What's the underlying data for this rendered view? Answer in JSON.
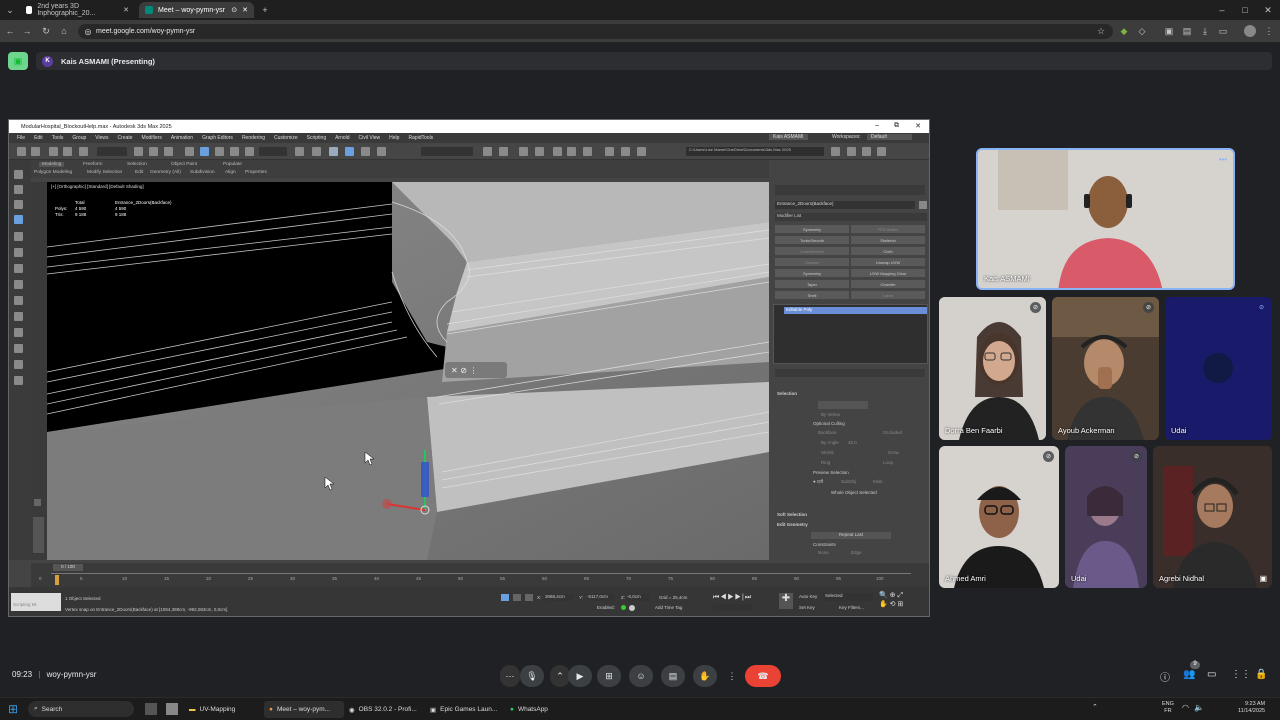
{
  "browser": {
    "tabs": [
      {
        "title": "2nd years 3D Inphographic_20..."
      },
      {
        "title": "Meet – woy-pymn-ysr"
      }
    ],
    "url": "meet.google.com/woy-pymn-ysr"
  },
  "meet": {
    "presenting_label": "Kais ASMAMI (Presenting)",
    "presenter_initial": "K",
    "time": "09:23",
    "meeting_code": "woy-pymn-ysr",
    "participants": [
      {
        "name": "Kais ASMAMI"
      },
      {
        "name": "Dorra Ben Faarbi"
      },
      {
        "name": "Ayoub Ackerman"
      },
      {
        "name": "Udai"
      },
      {
        "name": "Ahmed Amri"
      },
      {
        "name": "Udai"
      },
      {
        "name": "Agrebi Nidhal"
      }
    ],
    "people_badge": "9"
  },
  "max": {
    "title": "ModularHospital_BlockoutHelp.max - Autodesk 3ds Max 2025",
    "menu": [
      "File",
      "Edit",
      "Tools",
      "Group",
      "Views",
      "Create",
      "Modifiers",
      "Animation",
      "Graph Editors",
      "Rendering",
      "Customize",
      "Scripting",
      "Arnold",
      "Civil View",
      "Help",
      "RapidTools"
    ],
    "user": "Kais ASMAMI",
    "workspace_label": "Workspaces:",
    "workspace": "Default",
    "ribbon_tabs": [
      "Modeling",
      "Freeform",
      "Selection",
      "Object Paint",
      "Populate"
    ],
    "ribbon_sub": [
      "Polygon Modeling",
      "Modify Selection",
      "Edit",
      "Geometry (All)",
      "Subdivision",
      "Align",
      "Properties"
    ],
    "path": "C:\\Users\\Lise Mame\\OneDrive\\Documents\\3ds Max 2025",
    "viewport_label": "[+] [Orthographic] [Standard] [Default Shading]",
    "stats": {
      "h1": "Total",
      "h2": "Entrance_2Doors(Backface)",
      "polys_label": "Polys:",
      "polys_total": "4 590",
      "polys_sel": "4 590",
      "tris_label": "Tris:",
      "tris_total": "9 188",
      "tris_sel": "9 188"
    },
    "object_name": "Entrance_2Doors(Backface)",
    "modifier_list": "Modifier List",
    "modifier_buttons": [
      "Symmetry",
      "FFD Select",
      "TurboSmooth",
      "Skeleton",
      "CrossSection",
      "Cloth",
      "Surface",
      "Unwrap UVW",
      "Symmetry",
      "UVW Mapping Clear",
      "Taper",
      "Chamfer",
      "Shell",
      "Lathe"
    ],
    "stack_item": "Editable Poly",
    "rollouts": {
      "selection": "Selection",
      "by_vertex": "By Vertex",
      "optional_culling": "Optional Culling",
      "backface": "Backface",
      "occluded": "Occluded",
      "by_angle": "By Angle",
      "angle_val": "45.0",
      "shrink": "Shrink",
      "grow": "Grow",
      "ring": "Ring",
      "loop": "Loop",
      "preview_selection": "Preview Selection",
      "off": "Off",
      "subobj": "SubObj",
      "multi": "Multi",
      "whole_object": "Whole Object Selected",
      "soft_selection": "Soft Selection",
      "edit_geometry": "Edit Geometry",
      "repeat_last": "Repeat Last",
      "constraints": "Constraints",
      "none": "None",
      "edge": "Edge"
    },
    "frame": "0 / 100",
    "ticks": [
      "0",
      "5",
      "10",
      "15",
      "20",
      "25",
      "30",
      "35",
      "40",
      "45",
      "50",
      "55",
      "60",
      "65",
      "70",
      "75",
      "80",
      "85",
      "90",
      "95",
      "100"
    ],
    "status_line1": "1 Object Selected",
    "status_line2": "Vertex snap on Entrance_2Doors(Backface) at [1094,388cm, -992,083cm, 0,0cm]",
    "maxscript": "Scripting Mi",
    "coord_x": "3068,4cm",
    "coord_y": "-5117,0cm",
    "coord_z": "-0,0cm",
    "grid": "Grid = 25,4cm",
    "enabled": "Enabled:",
    "add_time_tag": "Add Time Tag",
    "auto_key": "Auto Key",
    "set_key": "Set Key",
    "selected": "Selected",
    "key_filters": "Key Filters..."
  },
  "taskbar": {
    "search": "Search",
    "apps": [
      "UV-Mapping",
      "Meet – woy-pym...",
      "OBS 32.0.2 - Profi...",
      "Epic Games Laun...",
      "WhatsApp"
    ],
    "lang1": "ENG",
    "lang2": "FR",
    "time": "9:23 AM",
    "date": "11/14/2025"
  }
}
